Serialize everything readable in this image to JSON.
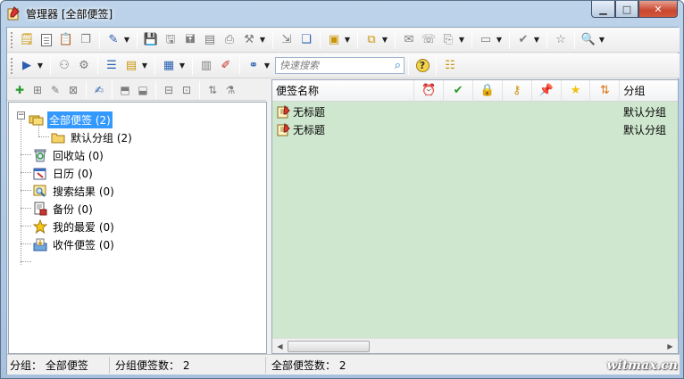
{
  "window": {
    "title": "管理器 [全部便签]"
  },
  "toolbar2": {
    "search_placeholder": "快速搜索"
  },
  "tree": {
    "nodes": [
      {
        "label": "全部便签 (2)",
        "icon": "folders-icon"
      },
      {
        "label": "默认分组 (2)",
        "icon": "folder-icon"
      },
      {
        "label": "回收站 (0)",
        "icon": "recycle-bin-icon"
      },
      {
        "label": "日历 (0)",
        "icon": "calendar-icon"
      },
      {
        "label": "搜索结果 (0)",
        "icon": "search-results-icon"
      },
      {
        "label": "备份 (0)",
        "icon": "backup-icon"
      },
      {
        "label": "我的最爱 (0)",
        "icon": "star-icon"
      },
      {
        "label": "收件便签 (0)",
        "icon": "inbox-icon"
      }
    ]
  },
  "list": {
    "columns": {
      "name": "便签名称",
      "group": "分组"
    },
    "rows": [
      {
        "title": "无标题",
        "group": "默认分组"
      },
      {
        "title": "无标题",
        "group": "默认分组"
      }
    ]
  },
  "status": {
    "group": "分组： 全部便签",
    "group_count": "分组便签数： 2",
    "total_count": "全部便签数： 2"
  },
  "watermark": "witmax.cn",
  "colors": {
    "list_background": "#cfe7cf",
    "selection": "#3399ff",
    "close_button": "#c9462d"
  }
}
